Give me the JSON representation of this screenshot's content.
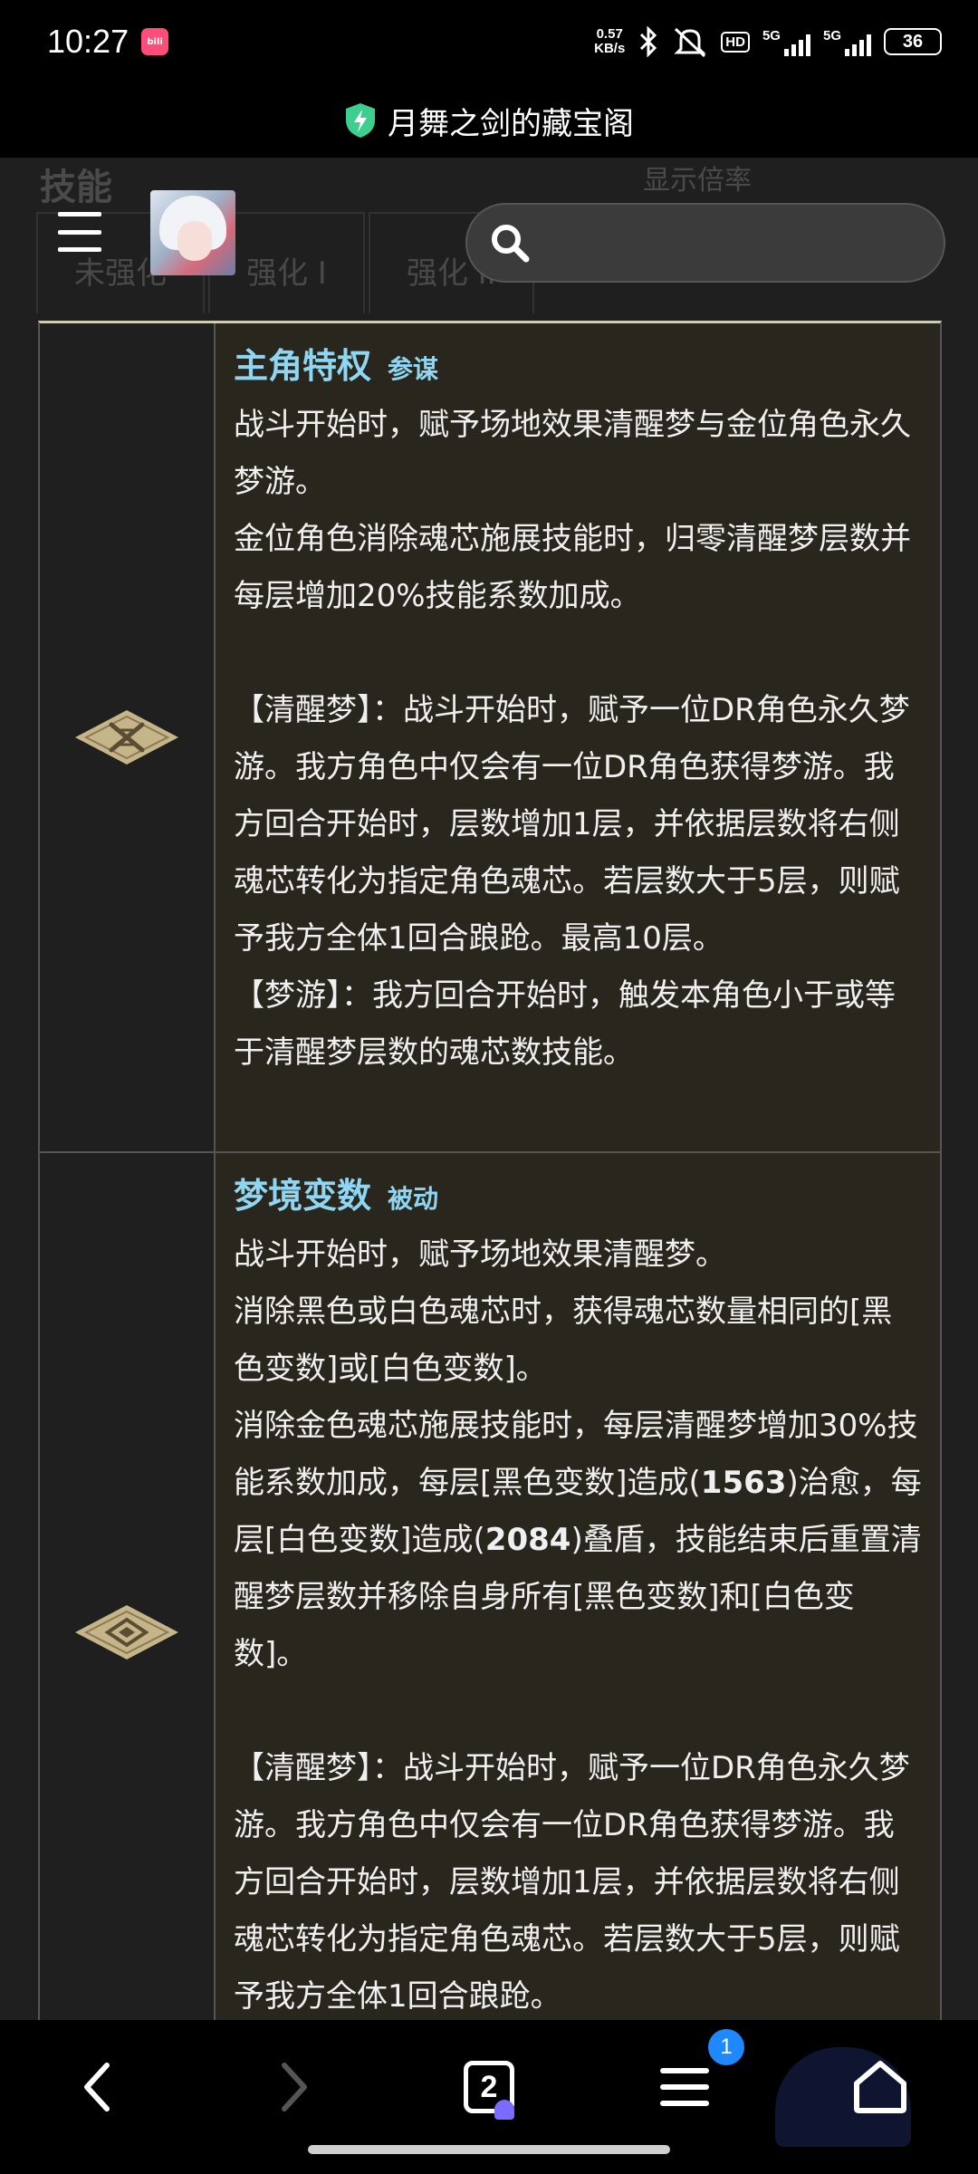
{
  "status_bar": {
    "time": "10:27",
    "net_speed_value": "0.57",
    "net_speed_unit": "KB/s",
    "hd_badge": "HD",
    "net1": "5G",
    "net2": "5G",
    "battery": "36",
    "icons": [
      "bilibili-app-icon",
      "bluetooth-icon",
      "mute-icon",
      "signal-icon",
      "signal-icon",
      "battery-icon"
    ]
  },
  "title_bar": {
    "title": "月舞之剑的藏宝阁",
    "icon": "shield-bolt-icon",
    "accent": "#3ecf8e"
  },
  "page_bg": {
    "section_title": "技能",
    "right_label": "显示倍率",
    "tabs": [
      "未强化",
      "强化 I",
      "强化 II"
    ]
  },
  "search": {
    "placeholder": "",
    "icon": "search-icon"
  },
  "skills": [
    {
      "name": "主角特权",
      "tag": "参谋",
      "icon": "crossed-swords-emblem-icon",
      "description": "战斗开始时，赋予场地效果清醒梦与金位角色永久梦游。\n金位角色消除魂芯施展技能时，归零清醒梦层数并每层增加20%技能系数加成。\n\n【清醒梦】：战斗开始时，赋予一位DR角色永久梦游。我方角色中仅会有一位DR角色获得梦游。我方回合开始时，层数增加1层，并依据层数将右侧魂芯转化为指定角色魂芯。若层数大于5层，则赋予我方全体1回合踉跄。最高10层。\n【梦游】：我方回合开始时，触发本角色小于或等于清醒梦层数的魂芯数技能。"
    },
    {
      "name": "梦境变数",
      "tag": "被动",
      "icon": "ornate-diamond-emblem-icon",
      "description_before": "战斗开始时，赋予场地效果清醒梦。\n消除黑色或白色魂芯时，获得魂芯数量相同的[黑色变数]或[白色变数]。\n消除金色魂芯施展技能时，每层清醒梦增加30%技能系数加成，每层[黑色变数]造成(",
      "heal_value": "1563",
      "description_mid": ")治愈，每层[白色变数]造成(",
      "shield_value": "2084",
      "description_after": ")叠盾，技能结束后重置清醒梦层数并移除自身所有[黑色变数]和[白色变数]。\n\n【清醒梦】：战斗开始时，赋予一位DR角色永久梦游。我方角色中仅会有一位DR角色获得梦游。我方回合开始时，层数增加1层，并依据层数将右侧魂芯转化为指定角色魂芯。若层数大于5层，则赋予我方全体1回合踉跄。"
    }
  ],
  "colors": {
    "skill_name": "#8fd6f2",
    "desc_bg": "#28261d",
    "emblem": "#c7b58a"
  },
  "bottom_nav": {
    "tab_count": "2",
    "menu_badge": "1",
    "icons": [
      "back-icon",
      "forward-icon",
      "tabs-icon",
      "menu-icon",
      "home-icon"
    ]
  }
}
